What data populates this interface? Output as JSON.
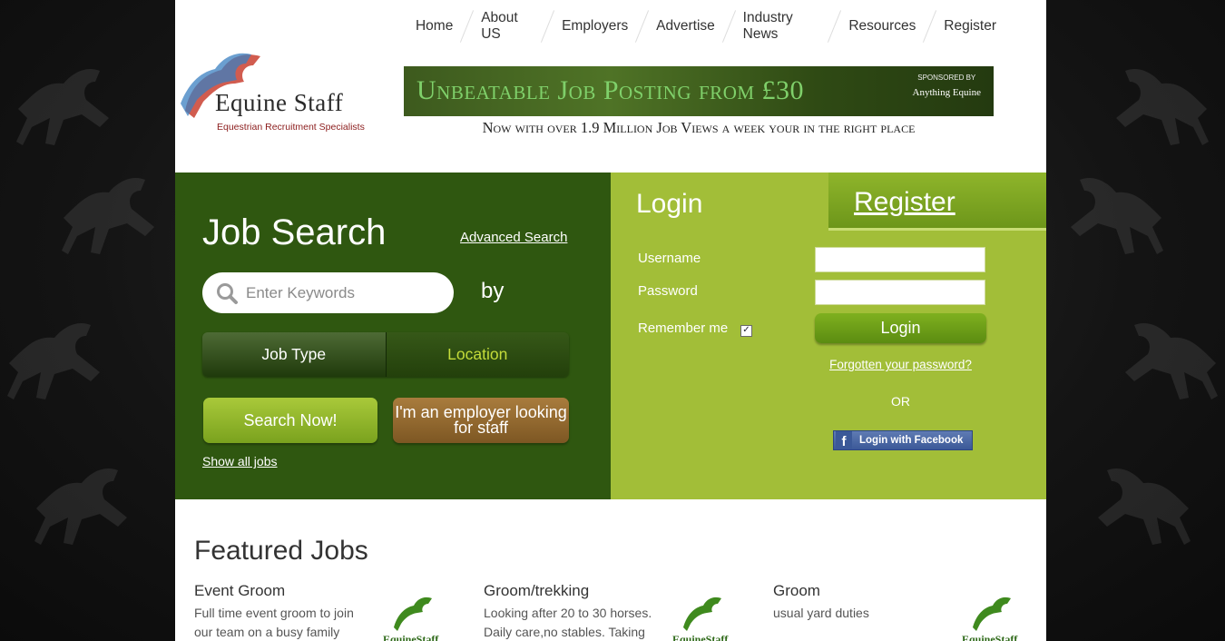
{
  "nav": [
    "Home",
    "About US",
    "Employers",
    "Advertise",
    "Industry News",
    "Resources",
    "Register"
  ],
  "logo": {
    "name": "Equine Staff",
    "tagline": "Equestrian Recruitment Specialists"
  },
  "banner": {
    "headline": "Unbeatable Job Posting from £30",
    "sponsored_by": "SPONSORED BY",
    "sponsor": "Anything Equine",
    "subline": "Now with over 1.9 Million Job Views a week your in the right place"
  },
  "search": {
    "title": "Job Search",
    "advanced_link": "Advanced Search",
    "keyword_placeholder": "Enter Keywords",
    "by": "by",
    "toggle": [
      "Job Type",
      "Location"
    ],
    "search_button": "Search Now!",
    "employer_button": "I'm an employer looking for staff",
    "show_all": "Show all jobs"
  },
  "login": {
    "tab_login": "Login",
    "tab_register": "Register",
    "username_label": "Username",
    "password_label": "Password",
    "remember_label": "Remember me",
    "login_button": "Login",
    "forgot": "Forgotten your password?",
    "or": "OR",
    "facebook": "Login with Facebook"
  },
  "featured": {
    "title": "Featured Jobs",
    "jobs": [
      {
        "title": "Event Groom",
        "desc": "Full time event groom to join our team on a busy family",
        "logo": "EquineStaff"
      },
      {
        "title": "Groom/trekking",
        "desc": "Looking after 20 to 30 horses. Daily care,no stables. Taking",
        "logo": "EquineStaff"
      },
      {
        "title": "Groom",
        "desc": "usual yard duties",
        "logo": "EquineStaff"
      }
    ]
  },
  "colors": {
    "search_green": "#2f5710",
    "login_green": "#a2be38",
    "accent": "#c4dc3a",
    "employer_brown": "#8a6330"
  }
}
